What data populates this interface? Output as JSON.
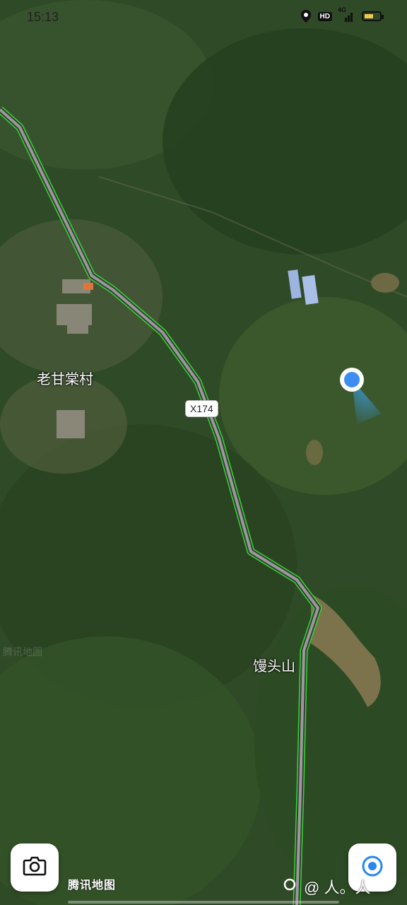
{
  "status_bar": {
    "time": "15:13",
    "hd_label": "HD",
    "network_label": "4G",
    "battery_level": 0.6
  },
  "map": {
    "labels": {
      "village": "老甘棠村",
      "mountain": "馒头山"
    },
    "road_shield": "X174",
    "watermark": "腾讯地图",
    "provider_logo": "腾讯地图",
    "colors": {
      "road_outline": "#2fdc2f",
      "road_fill": "#8c8c8c",
      "location_dot": "#3d8ef0"
    }
  },
  "controls": {
    "camera_button_icon": "camera-icon",
    "locate_button_icon": "locate-icon"
  },
  "bottom_overlay": {
    "text": "@ 人。人"
  }
}
